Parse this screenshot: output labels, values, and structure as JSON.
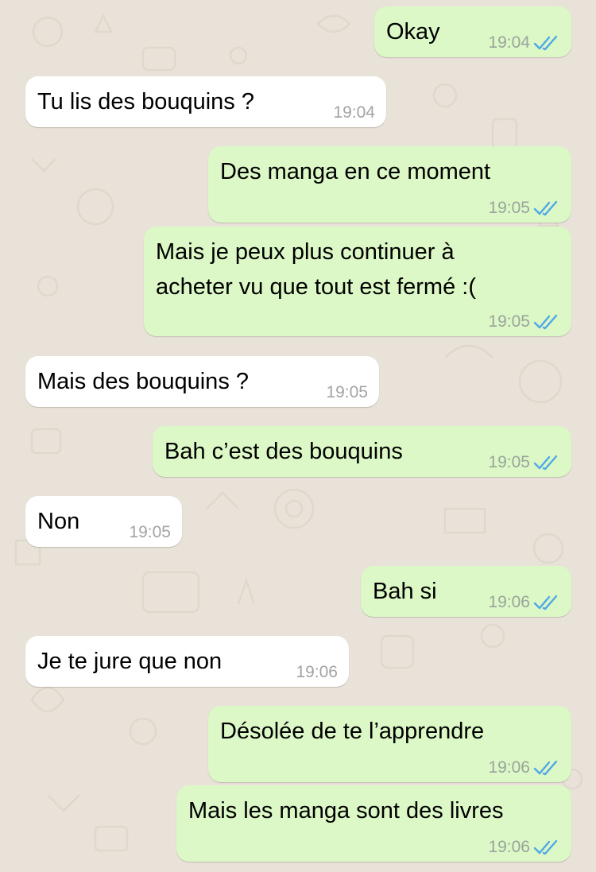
{
  "messages": [
    {
      "dir": "out",
      "text": "Okay",
      "time": "19:04",
      "read": true
    },
    {
      "dir": "in",
      "text": "Tu lis des bouquins ?",
      "time": "19:04"
    },
    {
      "dir": "out",
      "text": "Des manga en ce moment",
      "time": "19:05",
      "read": true
    },
    {
      "dir": "out",
      "text": "Mais je peux plus continuer à\nacheter vu que tout est fermé :(",
      "time": "19:05",
      "read": true
    },
    {
      "dir": "in",
      "text": "Mais des bouquins ?",
      "time": "19:05"
    },
    {
      "dir": "out",
      "text": "Bah c’est des bouquins",
      "time": "19:05",
      "read": true
    },
    {
      "dir": "in",
      "text": "Non",
      "time": "19:05"
    },
    {
      "dir": "out",
      "text": "Bah si",
      "time": "19:06",
      "read": true
    },
    {
      "dir": "in",
      "text": "Je te jure que non",
      "time": "19:06"
    },
    {
      "dir": "out",
      "text": "Désolée de te l’apprendre",
      "time": "19:06",
      "read": true
    },
    {
      "dir": "out",
      "text": "Mais les manga sont des livres",
      "time": "19:06",
      "read": true
    }
  ],
  "colors": {
    "background": "#e8e2d8",
    "outgoing_bubble": "#dcf8c6",
    "incoming_bubble": "#ffffff",
    "read_ticks": "#4fa8e6"
  },
  "icons": {
    "read_receipt": "double-check-icon"
  }
}
